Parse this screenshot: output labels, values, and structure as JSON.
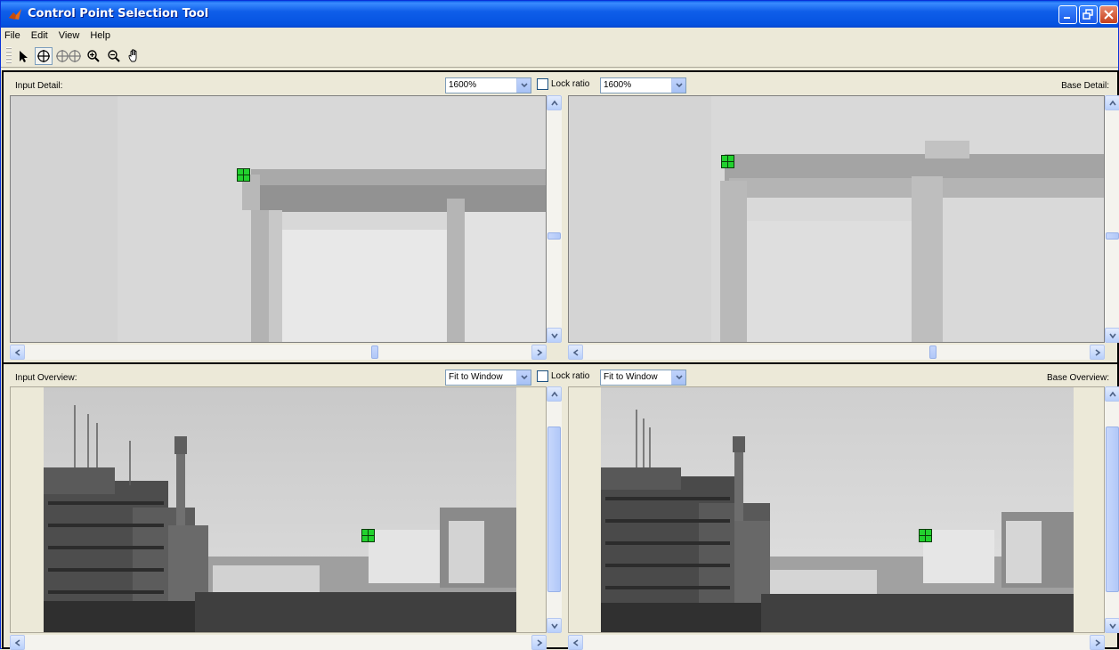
{
  "window": {
    "title": "Control Point Selection Tool",
    "icon": "matlab-icon",
    "controls": [
      "minimize-icon",
      "restore-icon",
      "close-icon"
    ]
  },
  "menu": [
    "File",
    "Edit",
    "View",
    "Help"
  ],
  "toolbar": {
    "tools": [
      "select-arrow-icon",
      "add-point-icon",
      "add-point-pair-icon",
      "zoom-in-icon",
      "zoom-out-icon",
      "pan-hand-icon"
    ],
    "active": "add-point-icon"
  },
  "detail": {
    "input_label": "Input Detail:",
    "base_label": "Base Detail:",
    "input_zoom": "1600%",
    "base_zoom": "1600%",
    "lock_label": "Lock ratio",
    "lock_checked": false
  },
  "overview": {
    "input_label": "Input Overview:",
    "base_label": "Base Overview:",
    "input_zoom": "Fit to Window",
    "base_zoom": "Fit to Window",
    "lock_label": "Lock ratio",
    "lock_checked": false
  },
  "colors": {
    "titlebar": "#0553e1",
    "chrome": "#ece9d8",
    "marker": "#22d12e"
  }
}
